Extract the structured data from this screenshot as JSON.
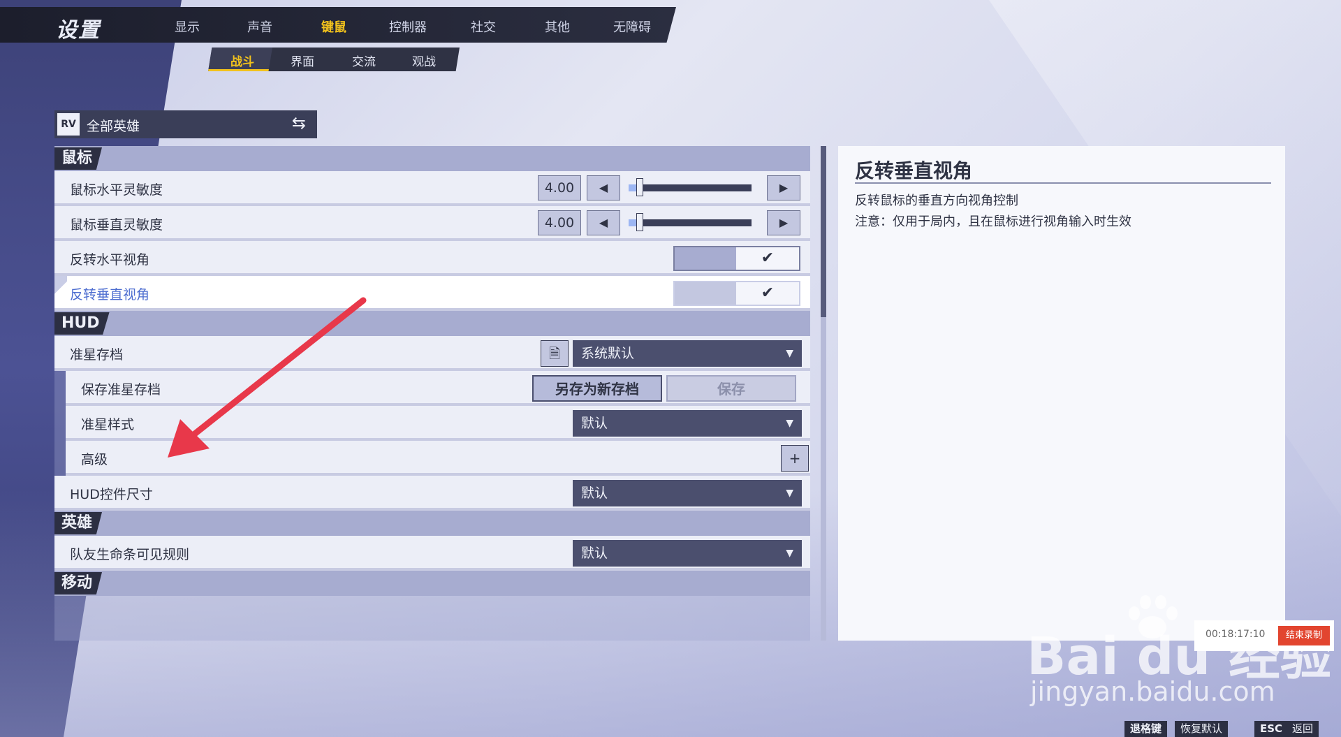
{
  "window": {
    "title": "设置"
  },
  "nav": {
    "tabs": [
      "显示",
      "声音",
      "键鼠",
      "控制器",
      "社交",
      "其他",
      "无障碍"
    ],
    "active": "键鼠"
  },
  "subnav": {
    "tabs": [
      "战斗",
      "界面",
      "交流",
      "观战"
    ],
    "active": "战斗"
  },
  "hero_selector": {
    "logo": "RV",
    "label": "全部英雄",
    "swap_icon": "⇆"
  },
  "sections": {
    "mouse": {
      "title": "鼠标",
      "h_sens": {
        "label": "鼠标水平灵敏度",
        "value": "4.00",
        "slider_fraction": 0.06
      },
      "v_sens": {
        "label": "鼠标垂直灵敏度",
        "value": "4.00",
        "slider_fraction": 0.06
      },
      "invert_h": {
        "label": "反转水平视角",
        "on": true
      },
      "invert_v": {
        "label": "反转垂直视角",
        "on": true
      }
    },
    "hud": {
      "title": "HUD",
      "crosshair_profile": {
        "label": "准星存档",
        "value": "系统默认"
      },
      "save_crosshair": {
        "label": "保存准星存档",
        "save_as_new": "另存为新存档",
        "save": "保存"
      },
      "crosshair_style": {
        "label": "准星样式",
        "value": "默认"
      },
      "advanced": {
        "label": "高级",
        "icon": "+"
      },
      "hud_size": {
        "label": "HUD控件尺寸",
        "value": "默认"
      }
    },
    "hero": {
      "title": "英雄",
      "teammate_hp": {
        "label": "队友生命条可见规则",
        "value": "默认"
      }
    },
    "move": {
      "title": "移动"
    }
  },
  "description": {
    "title": "反转垂直视角",
    "line1": "反转鼠标的垂直方向视角控制",
    "line2": "注意：仅用于局内，且在鼠标进行视角输入时生效"
  },
  "watermark": {
    "brand": "Bai du 经验",
    "url": "jingyan.baidu.com"
  },
  "recording": {
    "time": "00:18:17:10",
    "stop_label": "结束录制"
  },
  "bottom_hints": {
    "key1": "退格键",
    "label1": "恢复默认",
    "key2": "ESC",
    "label2": "返回"
  },
  "symbols": {
    "left": "◀",
    "right": "▶",
    "check": "✔",
    "caret": "▼"
  },
  "colors": {
    "accent": "#f2c21c",
    "highlight_text": "#4e6ed0",
    "dark": "#2c2f42"
  }
}
